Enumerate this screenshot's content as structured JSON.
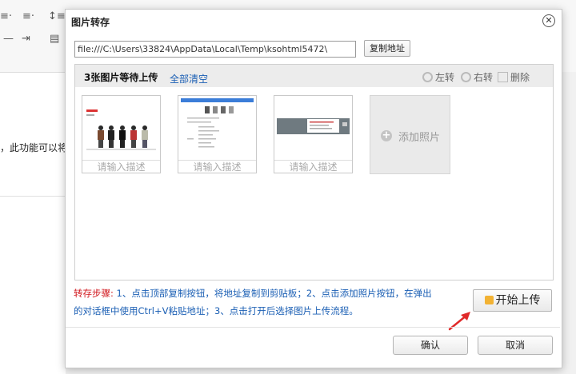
{
  "background": {
    "toolbar_glyphs": [
      "≡·",
      "≡·",
      "↕≡",
      "—",
      "⇥",
      "▤"
    ],
    "body_text": "，此功能可以将"
  },
  "dialog": {
    "title": "图片转存",
    "close_glyph": "✕",
    "url_value": "file:///C:\\Users\\33824\\AppData\\Local\\Temp\\ksohtml5472\\",
    "copy_button": "复制地址",
    "panel": {
      "count_text": "3张图片等待上传",
      "clear_all": "全部清空",
      "rotate_left": "左转",
      "rotate_right": "右转",
      "delete": "删除"
    },
    "thumbnails": [
      {
        "desc_placeholder": "请输入描述"
      },
      {
        "desc_placeholder": "请输入描述"
      },
      {
        "desc_placeholder": "请输入描述"
      }
    ],
    "add_photo": "添加照片",
    "steps_label": "转存步骤:",
    "steps_text": " 1、点击顶部复制按钮，将地址复制到剪贴板；2、点击添加照片按钮，在弹出的对话框中使用Ctrl+V粘贴地址；3、点击打开后选择图片上传流程。",
    "upload_button": "开始上传",
    "ok_button": "确认",
    "cancel_button": "取消"
  },
  "colors": {
    "link_blue": "#1b5fb4",
    "steps_red": "#d0161c",
    "arrow_red": "#e02a2a"
  }
}
